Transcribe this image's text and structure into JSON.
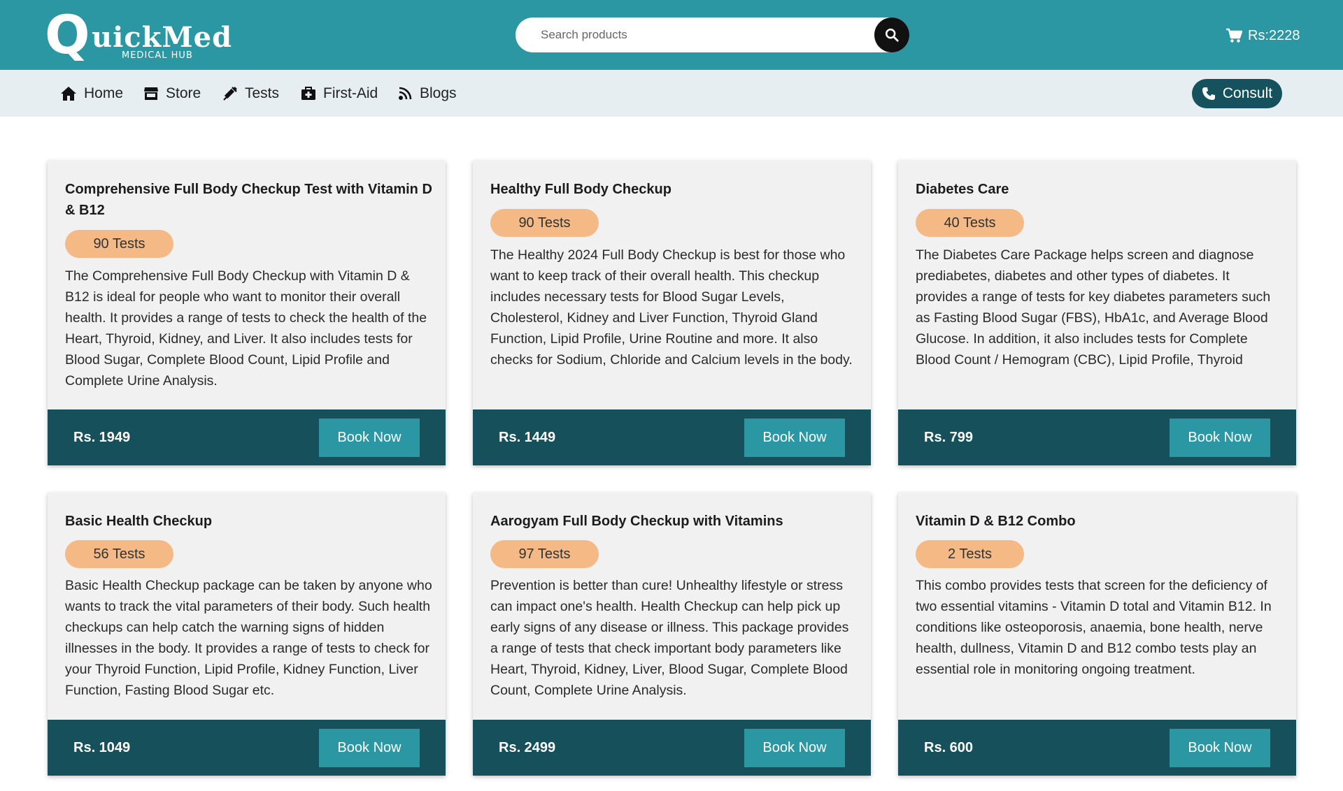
{
  "header": {
    "logo": {
      "letter": "Q",
      "word": "uickMed",
      "subtitle": "MEDICAL HUB"
    },
    "search": {
      "placeholder": "Search products",
      "value": ""
    },
    "cart": {
      "label": "Rs:2228"
    }
  },
  "nav": {
    "items": [
      {
        "label": "Home",
        "icon": "home-icon"
      },
      {
        "label": "Store",
        "icon": "store-icon"
      },
      {
        "label": "Tests",
        "icon": "syringe-icon"
      },
      {
        "label": "First-Aid",
        "icon": "first-aid-kit-icon"
      },
      {
        "label": "Blogs",
        "icon": "blog-icon"
      }
    ],
    "consult_label": "Consult"
  },
  "colors": {
    "header_bg": "#2b97a3",
    "nav_bg": "#e6eef2",
    "card_bg": "#f1f1f1",
    "card_footer_bg": "#16505b",
    "badge_bg": "#f4b984",
    "button_bg": "#2b97a3",
    "consult_bg": "#16525e"
  },
  "cards": [
    {
      "title": "Comprehensive Full Body Checkup Test with Vitamin D & B12",
      "tests": "90 Tests",
      "description": "The Comprehensive Full Body Checkup with Vitamin D & B12 is ideal for people who want to monitor their overall health. It provides a range of tests to check the health of the Heart, Thyroid, Kidney, and Liver. It also includes tests for Blood Sugar, Complete Blood Count, Lipid Profile and Complete Urine Analysis.",
      "price": "Rs. 1949",
      "button": "Book Now"
    },
    {
      "title": "Healthy Full Body Checkup",
      "tests": "90 Tests",
      "description": "The Healthy 2024 Full Body Checkup is best for those who want to keep track of their overall health. This checkup includes necessary tests for Blood Sugar Levels, Cholesterol, Kidney and Liver Function, Thyroid Gland Function, Lipid Profile, Urine Routine and more. It also checks for Sodium, Chloride and Calcium levels in the body.",
      "price": "Rs. 1449",
      "button": "Book Now"
    },
    {
      "title": "Diabetes Care",
      "tests": "40 Tests",
      "description": "The Diabetes Care Package helps screen and diagnose prediabetes, diabetes and other types of diabetes. It provides a range of tests for key diabetes parameters such as Fasting Blood Sugar (FBS), HbA1c, and Average Blood Glucose. In addition, it also includes tests for Complete Blood Count / Hemogram (CBC), Lipid Profile, Thyroid",
      "price": "Rs. 799",
      "button": "Book Now"
    },
    {
      "title": "Basic Health Checkup",
      "tests": "56 Tests",
      "description": "Basic Health Checkup package can be taken by anyone who wants to track the vital parameters of their body. Such health checkups can help catch the warning signs of hidden illnesses in the body. It provides a range of tests to check for your Thyroid Function, Lipid Profile, Kidney Function, Liver Function, Fasting Blood Sugar etc.",
      "price": "Rs. 1049",
      "button": "Book Now"
    },
    {
      "title": "Aarogyam Full Body Checkup with Vitamins",
      "tests": "97 Tests",
      "description": "Prevention is better than cure! Unhealthy lifestyle or stress can impact one's health. Health Checkup can help pick up early signs of any disease or illness. This package provides a range of tests that check important body parameters like Heart, Thyroid, Kidney, Liver, Blood Sugar, Complete Blood Count, Complete Urine Analysis.",
      "price": "Rs. 2499",
      "button": "Book Now"
    },
    {
      "title": "Vitamin D & B12 Combo",
      "tests": "2 Tests",
      "description": "This combo provides tests that screen for the deficiency of two essential vitamins - Vitamin D total and Vitamin B12. In conditions like osteoporosis, anaemia, bone health, nerve health, dullness, Vitamin D and B12 combo tests play an essential role in monitoring ongoing treatment.",
      "price": "Rs. 600",
      "button": "Book Now"
    }
  ]
}
